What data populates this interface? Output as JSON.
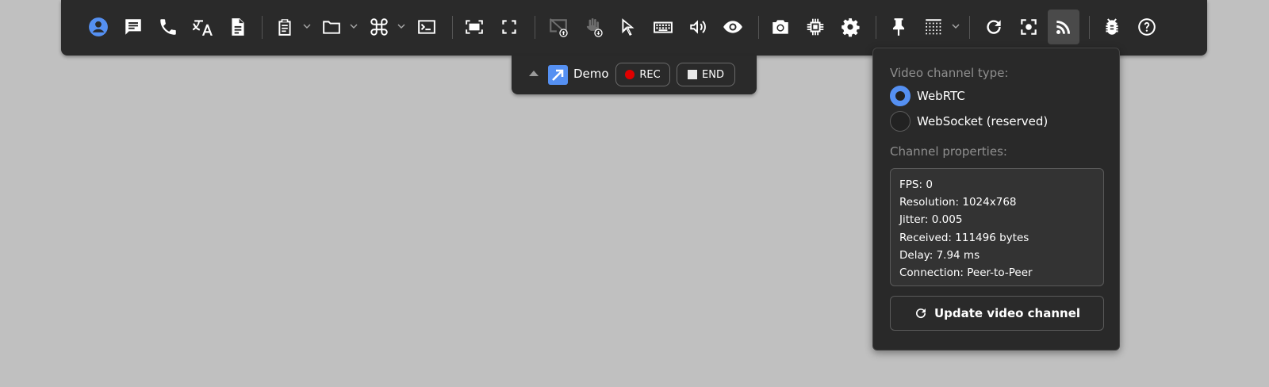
{
  "toolbar": {
    "buttons": [
      {
        "icon": "account-circle-icon",
        "state": "active-blue"
      },
      {
        "icon": "chat-icon"
      },
      {
        "icon": "phone-icon"
      },
      {
        "icon": "translate-icon"
      },
      {
        "icon": "document-icon"
      },
      {
        "icon": "clipboard-icon",
        "dropdown": true
      },
      {
        "icon": "folder-icon",
        "dropdown": true
      },
      {
        "icon": "command-key-icon",
        "dropdown": true
      },
      {
        "icon": "terminal-icon"
      },
      {
        "icon": "fit-screen-icon"
      },
      {
        "icon": "fullscreen-icon"
      },
      {
        "icon": "screen-share-upload-icon",
        "state": "disabled"
      },
      {
        "icon": "hand-download-icon",
        "state": "disabled"
      },
      {
        "icon": "cursor-icon"
      },
      {
        "icon": "keyboard-icon"
      },
      {
        "icon": "volume-icon"
      },
      {
        "icon": "eye-icon"
      },
      {
        "icon": "camera-icon"
      },
      {
        "icon": "cpu-chip-icon"
      },
      {
        "icon": "gear-icon"
      },
      {
        "icon": "pin-icon"
      },
      {
        "icon": "grid-dots-icon",
        "dropdown": true
      },
      {
        "icon": "refresh-icon"
      },
      {
        "icon": "focus-center-icon"
      },
      {
        "icon": "rss-feed-icon",
        "state": "selected"
      },
      {
        "icon": "bug-icon"
      },
      {
        "icon": "help-icon"
      }
    ]
  },
  "session": {
    "name": "Demo",
    "rec_label": "REC",
    "end_label": "END"
  },
  "video_panel": {
    "type_heading": "Video channel type:",
    "options": [
      {
        "label": "WebRTC",
        "checked": true
      },
      {
        "label": "WebSocket (reserved)",
        "checked": false
      }
    ],
    "props_heading": "Channel properties:",
    "properties": [
      "FPS: 0",
      "Resolution: 1024x768",
      "Jitter: 0.005",
      "Received: 111496 bytes",
      "Delay: 7.94 ms",
      "Connection: Peer-to-Peer"
    ],
    "update_label": "Update video channel"
  },
  "colors": {
    "background": "#c0c0c0",
    "panel": "#2a2a2a",
    "accent": "#5590f2",
    "rec": "#e00000"
  }
}
